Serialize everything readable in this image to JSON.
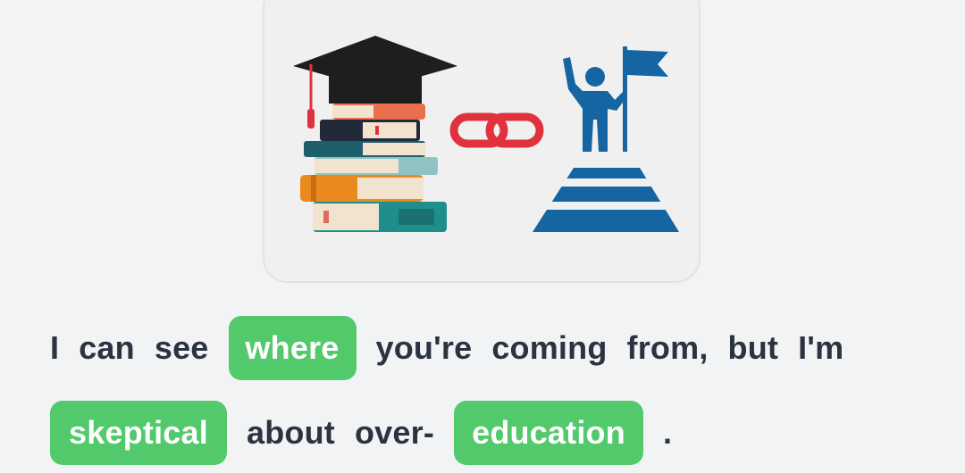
{
  "illustration": {
    "left_icon": "graduation-cap-books-icon",
    "middle_icon": "chain-link-icon",
    "right_icon": "person-flag-summit-icon",
    "colors": {
      "card_bg": "#f0f0f0",
      "link_red": "#e0323c",
      "summit_blue": "#1565a3",
      "cap_black": "#1e1e1e"
    }
  },
  "sentence": {
    "line1": {
      "w1": "I",
      "w2": "can",
      "w3": "see",
      "chip1": "where",
      "w4": "you're",
      "w5": "coming",
      "w6": "from,",
      "w7": "but",
      "w8": "I'm"
    },
    "line2": {
      "chip2": "skeptical",
      "w1": "about",
      "w2": "over-",
      "chip3": "education",
      "w3": "."
    }
  },
  "colors": {
    "chip_bg": "#52c96b",
    "chip_text": "#ffffff",
    "text": "#2b3340",
    "page_bg": "#f2f3f5"
  }
}
